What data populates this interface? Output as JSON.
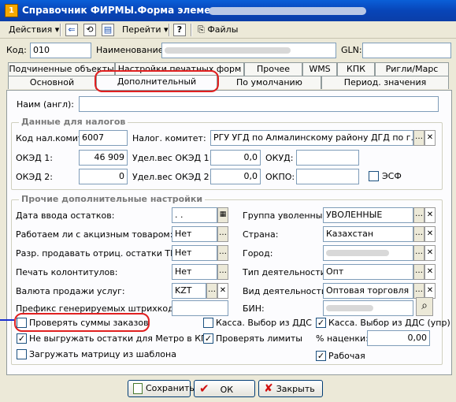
{
  "window": {
    "title": "Справочник ФИРМЫ.Форма элемента:"
  },
  "toolbar": {
    "actions": "Действия",
    "goto": "Перейти",
    "help": "?",
    "files": "Файлы"
  },
  "header": {
    "code_label": "Код:",
    "code_value": "010",
    "name_label": "Наименование:",
    "gln_label": "GLN:"
  },
  "tabs": {
    "row1": [
      "Подчиненные объекты",
      "Настройки печатных форм",
      "Прочее",
      "WMS",
      "КПК",
      "Ригли/Марс"
    ],
    "row2": [
      "Основной",
      "Дополнительный",
      "По умолчанию",
      "Период. значения"
    ]
  },
  "fields": {
    "name_en_label": "Наим (англ):"
  },
  "taxes": {
    "title": "Данные для налогов",
    "tax_code_label": "Код нал.комит:",
    "tax_code_value": "6007",
    "tax_committee_label": "Налог. комитет:",
    "tax_committee_value": "РГУ УГД по Алмалинскому району ДГД по г.Алм",
    "oked1_label": "ОКЭД 1:",
    "oked1_value": "46 909",
    "oked1_weight_label": "Удел.вес ОКЭД 1:",
    "oked1_weight_value": "0,0",
    "okud_label": "ОКУД:",
    "oked2_label": "ОКЭД 2:",
    "oked2_value": "0",
    "oked2_weight_label": "Удел.вес ОКЭД 2:",
    "oked2_weight_value": "0,0",
    "okpo_label": "ОКПО:",
    "esf_label": "ЭСФ"
  },
  "other": {
    "title": "Прочие дополнительные настройки",
    "balance_date_label": "Дата ввода остатков:",
    "balance_date_value": ". .",
    "excise_label": "Работаем ли с акцизным товаром:",
    "excise_value": "Нет",
    "neg_stock_label": "Разр. продавать отриц. остатки ТМЦ:",
    "neg_stock_value": "Нет",
    "print_footer_label": "Печать колонтитулов:",
    "print_footer_value": "Нет",
    "currency_label": "Валюта продажи услуг:",
    "currency_value": "KZT",
    "barcode_prefix_label": "Префикс генерируемых штрихкодов:",
    "dismissed_group_label": "Группа уволенные:",
    "dismissed_group_value": "УВОЛЕННЫЕ",
    "country_label": "Страна:",
    "country_value": "Казахстан",
    "city_label": "Город:",
    "activity_type_label": "Тип деятельности:",
    "activity_type_value": "Опт",
    "activity_kind_label": "Вид деятельности:",
    "activity_kind_value": "Оптовая торговля",
    "bin_label": "БИН:",
    "check_orders_label": "Проверять суммы заказов",
    "cash_dds_label": "Касса. Выбор из ДДС",
    "cash_dds_upr_label": "Касса. Выбор из ДДС (упр)",
    "no_metro_label": "Не выгружать остатки для Метро в КПК",
    "check_limits_label": "Проверять лимиты",
    "markup_label": "% наценки:",
    "markup_value": "0,00",
    "load_matrix_label": "Загружать матрицу из шаблона",
    "working_label": "Рабочая"
  },
  "footer": {
    "save": "Сохранить",
    "ok": "ОК",
    "close": "Закрыть"
  },
  "colors": {
    "title_bar": "#0845b8",
    "highlight": "#e02020"
  }
}
